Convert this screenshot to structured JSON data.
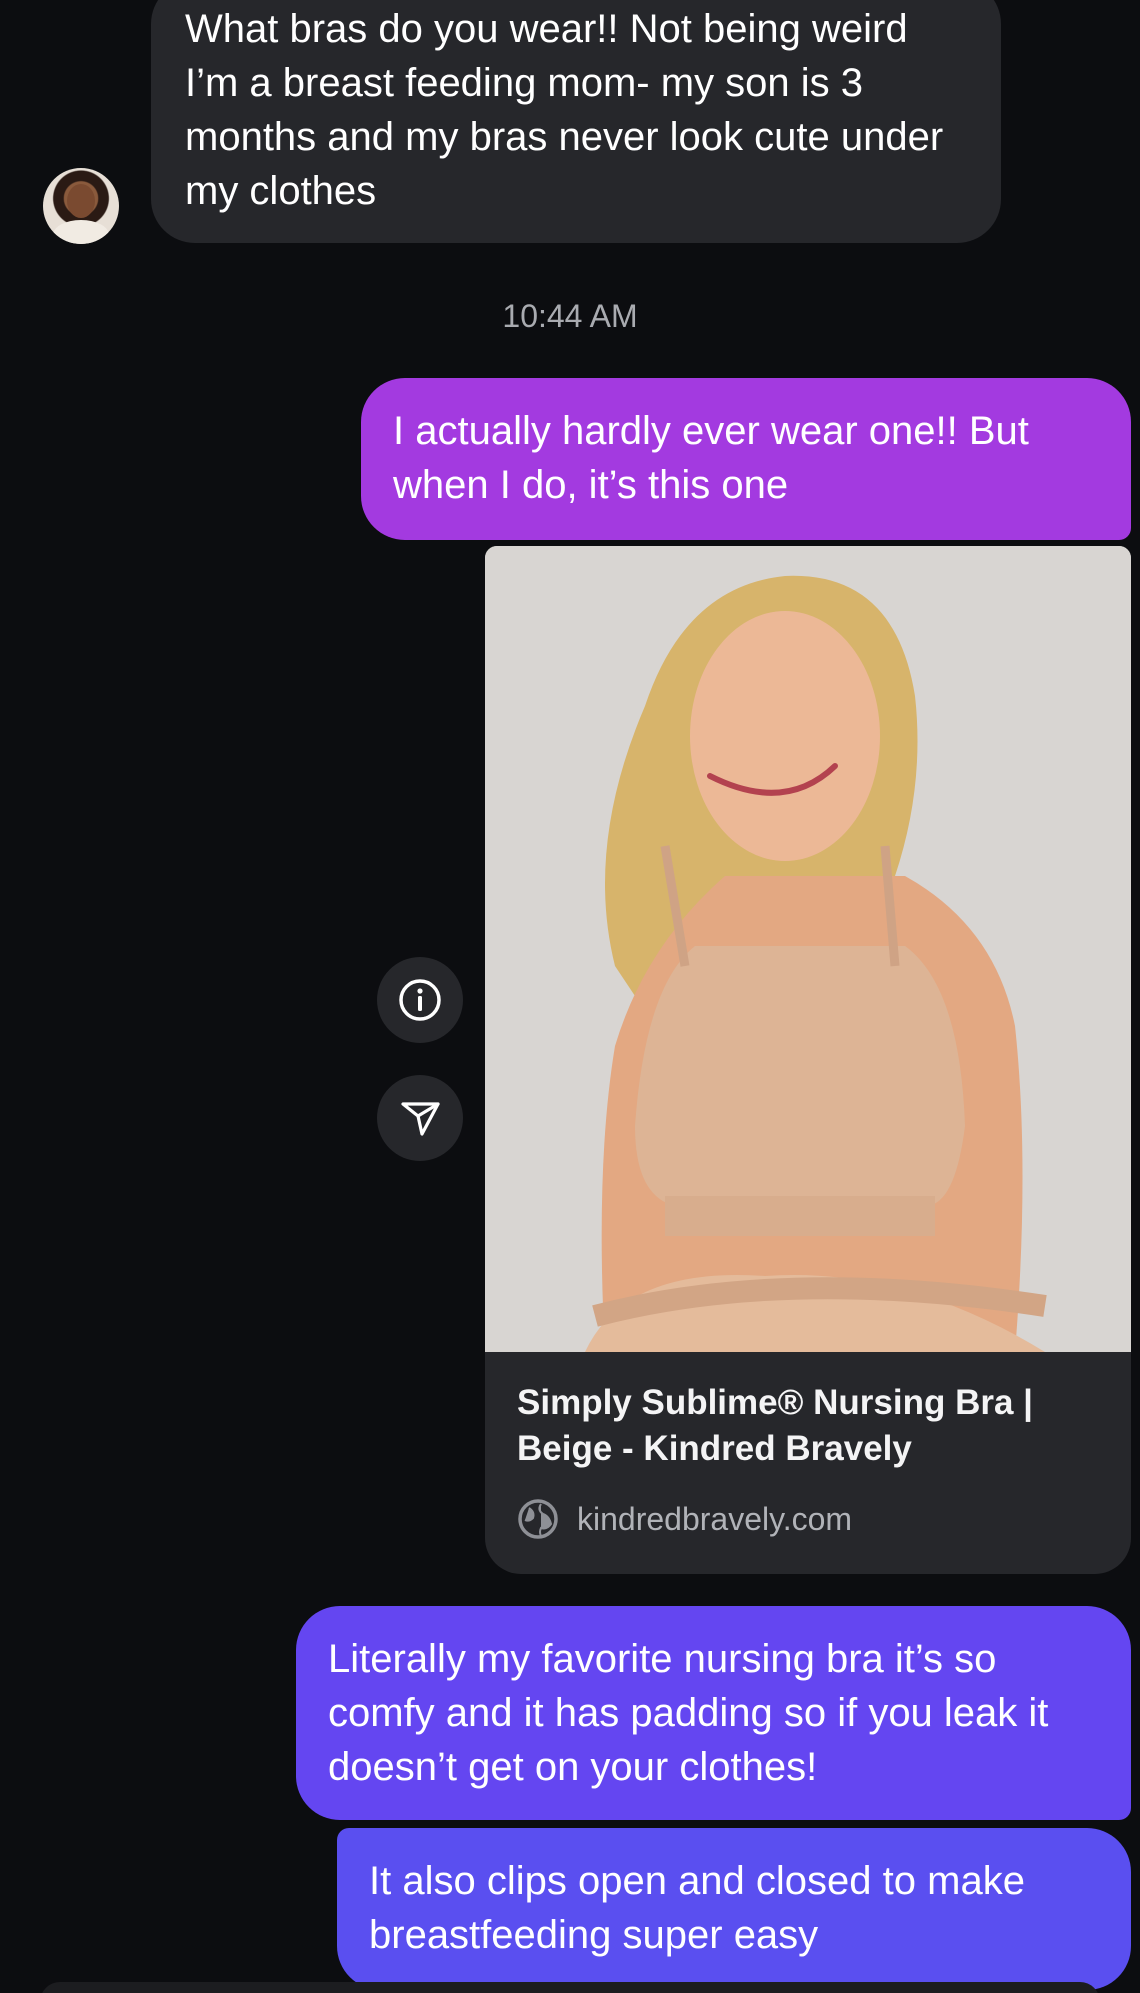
{
  "thread": {
    "incoming_message": "What bras do you wear!! Not being weird I’m a breast feeding mom- my son is 3 months and my bras never look cute under my clothes",
    "timestamp": "10:44 AM",
    "outgoing_1": "I actually hardly ever wear one!! But when I do, it’s this one",
    "link_preview": {
      "title": "Simply Sublime® Nursing Bra | Beige - Kindred Bravely",
      "domain": "kindredbravely.com"
    },
    "outgoing_2": "Literally my favorite nursing bra it’s so comfy and it has padding so if you leak it doesn’t get on your clothes!",
    "outgoing_3": "It also clips open and closed to make breastfeeding super easy"
  },
  "icons": {
    "info": "info-icon",
    "share": "share-icon",
    "globe": "globe-icon"
  },
  "colors": {
    "background": "#0c0d10",
    "incoming_bubble": "#26272b",
    "outgoing_purple": "#a33ae0",
    "outgoing_violet": "#6446f1",
    "outgoing_blue": "#5a4ff0"
  }
}
